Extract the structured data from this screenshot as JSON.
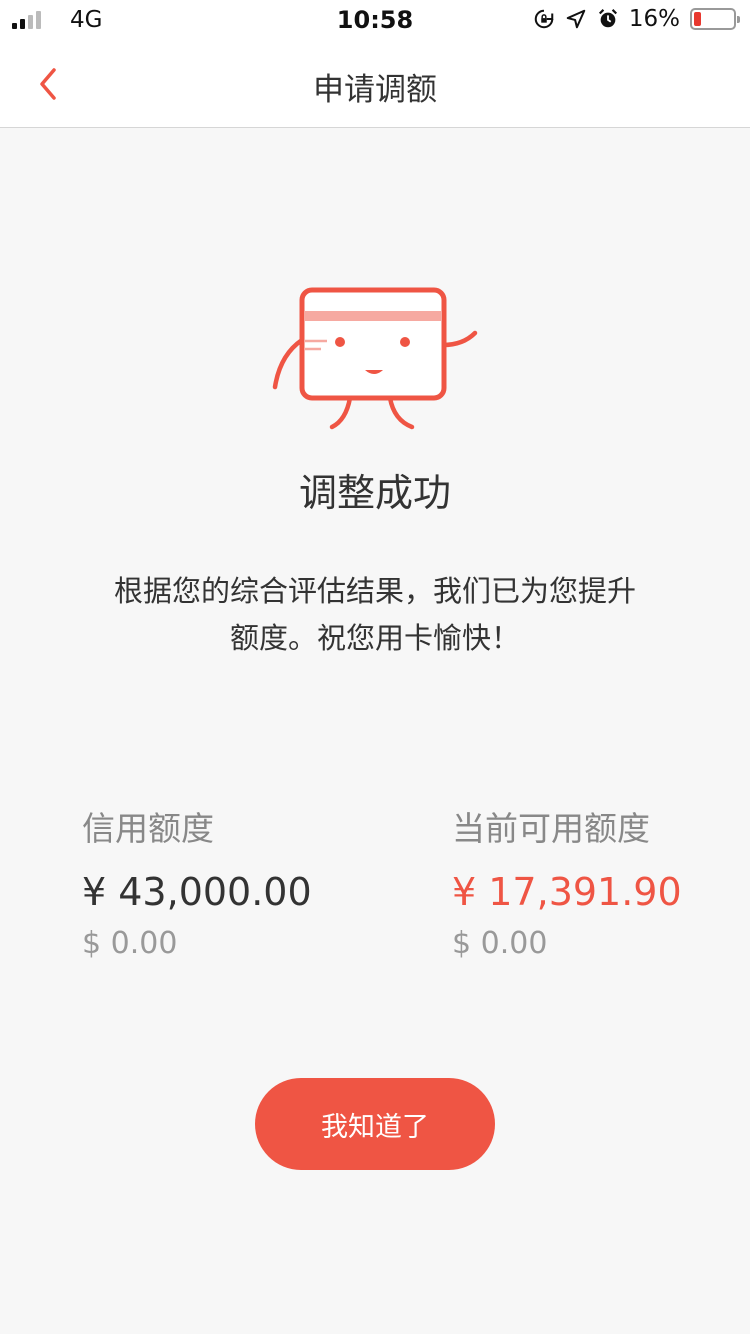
{
  "status_bar": {
    "network": "4G",
    "time": "10:58",
    "battery": "16%",
    "battery_level": 0.16
  },
  "nav": {
    "title": "申请调额"
  },
  "result": {
    "title": "调整成功",
    "description_line1": "根据您的综合评估结果，我们已为您提升",
    "description_line2": "额度。祝您用卡愉快！"
  },
  "credit_limit": {
    "label": "信用额度",
    "cny": "¥ 43,000.00",
    "usd": "$ 0.00"
  },
  "available_limit": {
    "label": "当前可用额度",
    "cny": "¥ 17,391.90",
    "usd": "$ 0.00"
  },
  "button": {
    "label": "我知道了"
  },
  "colors": {
    "accent": "#ef5544",
    "background": "#f7f7f7"
  }
}
